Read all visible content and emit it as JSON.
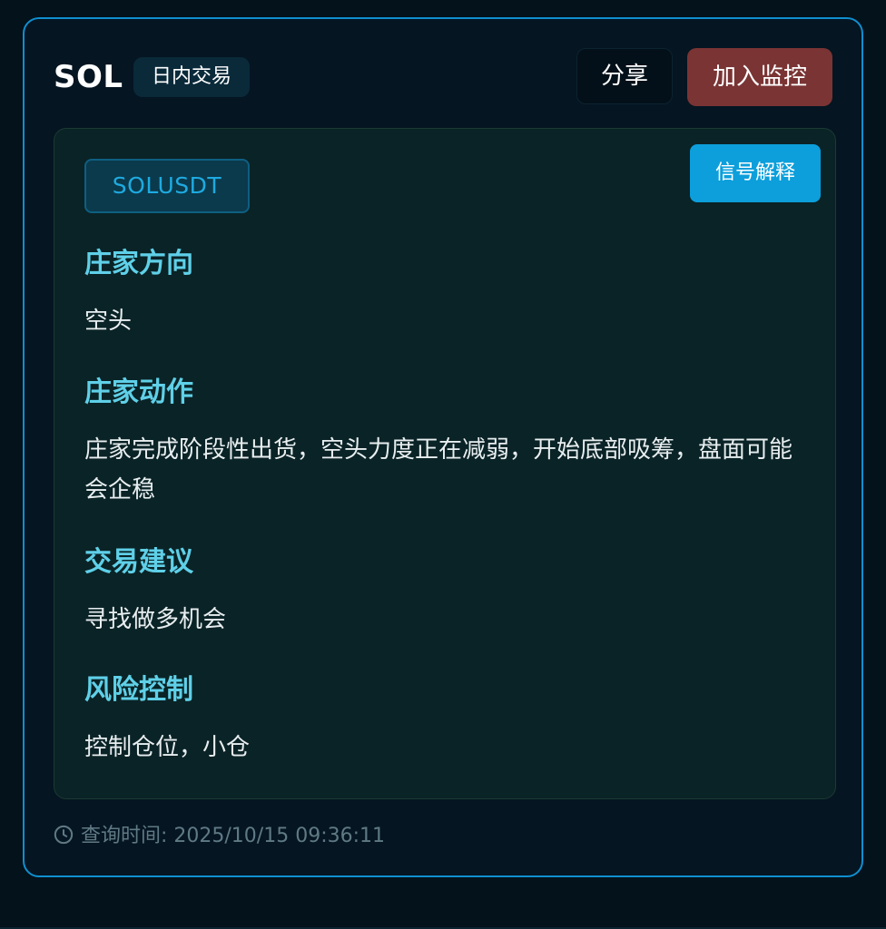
{
  "header": {
    "symbol": "SOL",
    "type_badge": "日内交易",
    "share_label": "分享",
    "monitor_label": "加入监控"
  },
  "signal": {
    "pair": "SOLUSDT",
    "explain_label": "信号解释",
    "sections": [
      {
        "title": "庄家方向",
        "body": "空头"
      },
      {
        "title": "庄家动作",
        "body": "庄家完成阶段性出货，空头力度正在减弱，开始底部吸筹，盘面可能会企稳"
      },
      {
        "title": "交易建议",
        "body": "寻找做多机会"
      },
      {
        "title": "风险控制",
        "body": "控制仓位，小仓"
      }
    ]
  },
  "footer": {
    "icon": "clock-icon",
    "query_time": "查询时间: 2025/10/15 09:36:11"
  },
  "colors": {
    "background": "#04121c",
    "card_border": "#0f8fcf",
    "monitor_button": "#7a3434",
    "explain_button": "#0c9fdb",
    "section_title": "#5fd0e8",
    "pair_text": "#1eaae0"
  }
}
